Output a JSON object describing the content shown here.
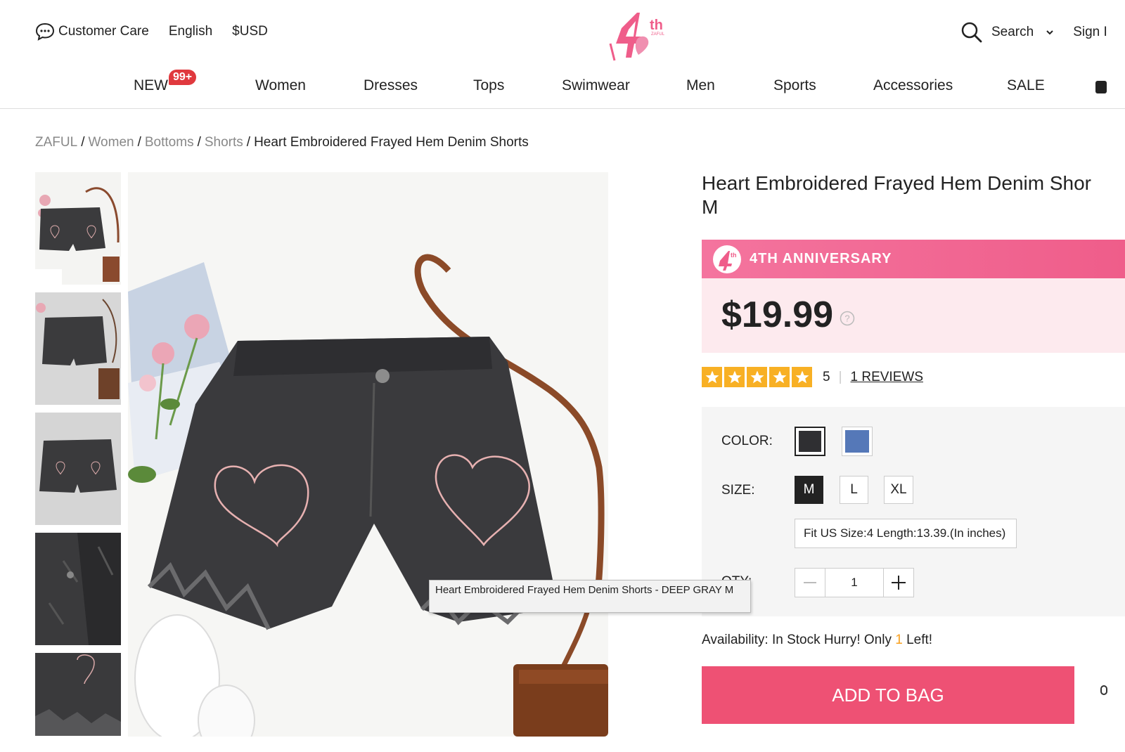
{
  "top": {
    "customer_care": "Customer Care",
    "language": "English",
    "currency": "$USD",
    "search_label": "Search",
    "sign_in_label": "Sign I"
  },
  "nav": {
    "items": [
      "NEW",
      "Women",
      "Dresses",
      "Tops",
      "Swimwear",
      "Men",
      "Sports",
      "Accessories",
      "SALE"
    ],
    "new_badge": "99+"
  },
  "breadcrumb": {
    "items": [
      "ZAFUL",
      "Women",
      "Bottoms",
      "Shorts"
    ],
    "current": "Heart Embroidered Frayed Hem Denim Shorts"
  },
  "product": {
    "title_line1": "Heart Embroidered Frayed Hem Denim Shor",
    "title_line2": "M",
    "anniversary": "4TH ANNIVERSARY",
    "price": "$19.99",
    "rating": "5",
    "rating_stars": 5,
    "reviews_link": "1 REVIEWS",
    "color_label": "COLOR:",
    "colors": [
      {
        "name": "deep gray",
        "hex": "#2f2f32",
        "selected": true
      },
      {
        "name": "blue",
        "hex": "#5578b8",
        "selected": false
      }
    ],
    "size_label": "SIZE:",
    "sizes": [
      {
        "label": "M",
        "selected": true
      },
      {
        "label": "L",
        "selected": false
      },
      {
        "label": "XL",
        "selected": false
      }
    ],
    "fit_info": "Fit US Size:4   Length:13.39.(In inches)",
    "qty_label": "QTY:",
    "qty_value": "1",
    "availability_prefix": "Availability: In Stock Hurry! Only ",
    "availability_count": "1",
    "availability_suffix": " Left!",
    "add_to_bag": "ADD TO BAG"
  },
  "tooltip": {
    "text": "Heart Embroidered Frayed Hem Denim Shorts - DEEP GRAY M"
  },
  "colors": {
    "pink_accent": "#ee5174",
    "anniversary_bar": "#f4749e",
    "price_bg": "#fdeaee",
    "star": "#f8b024",
    "stock_highlight": "#f8a01f"
  }
}
